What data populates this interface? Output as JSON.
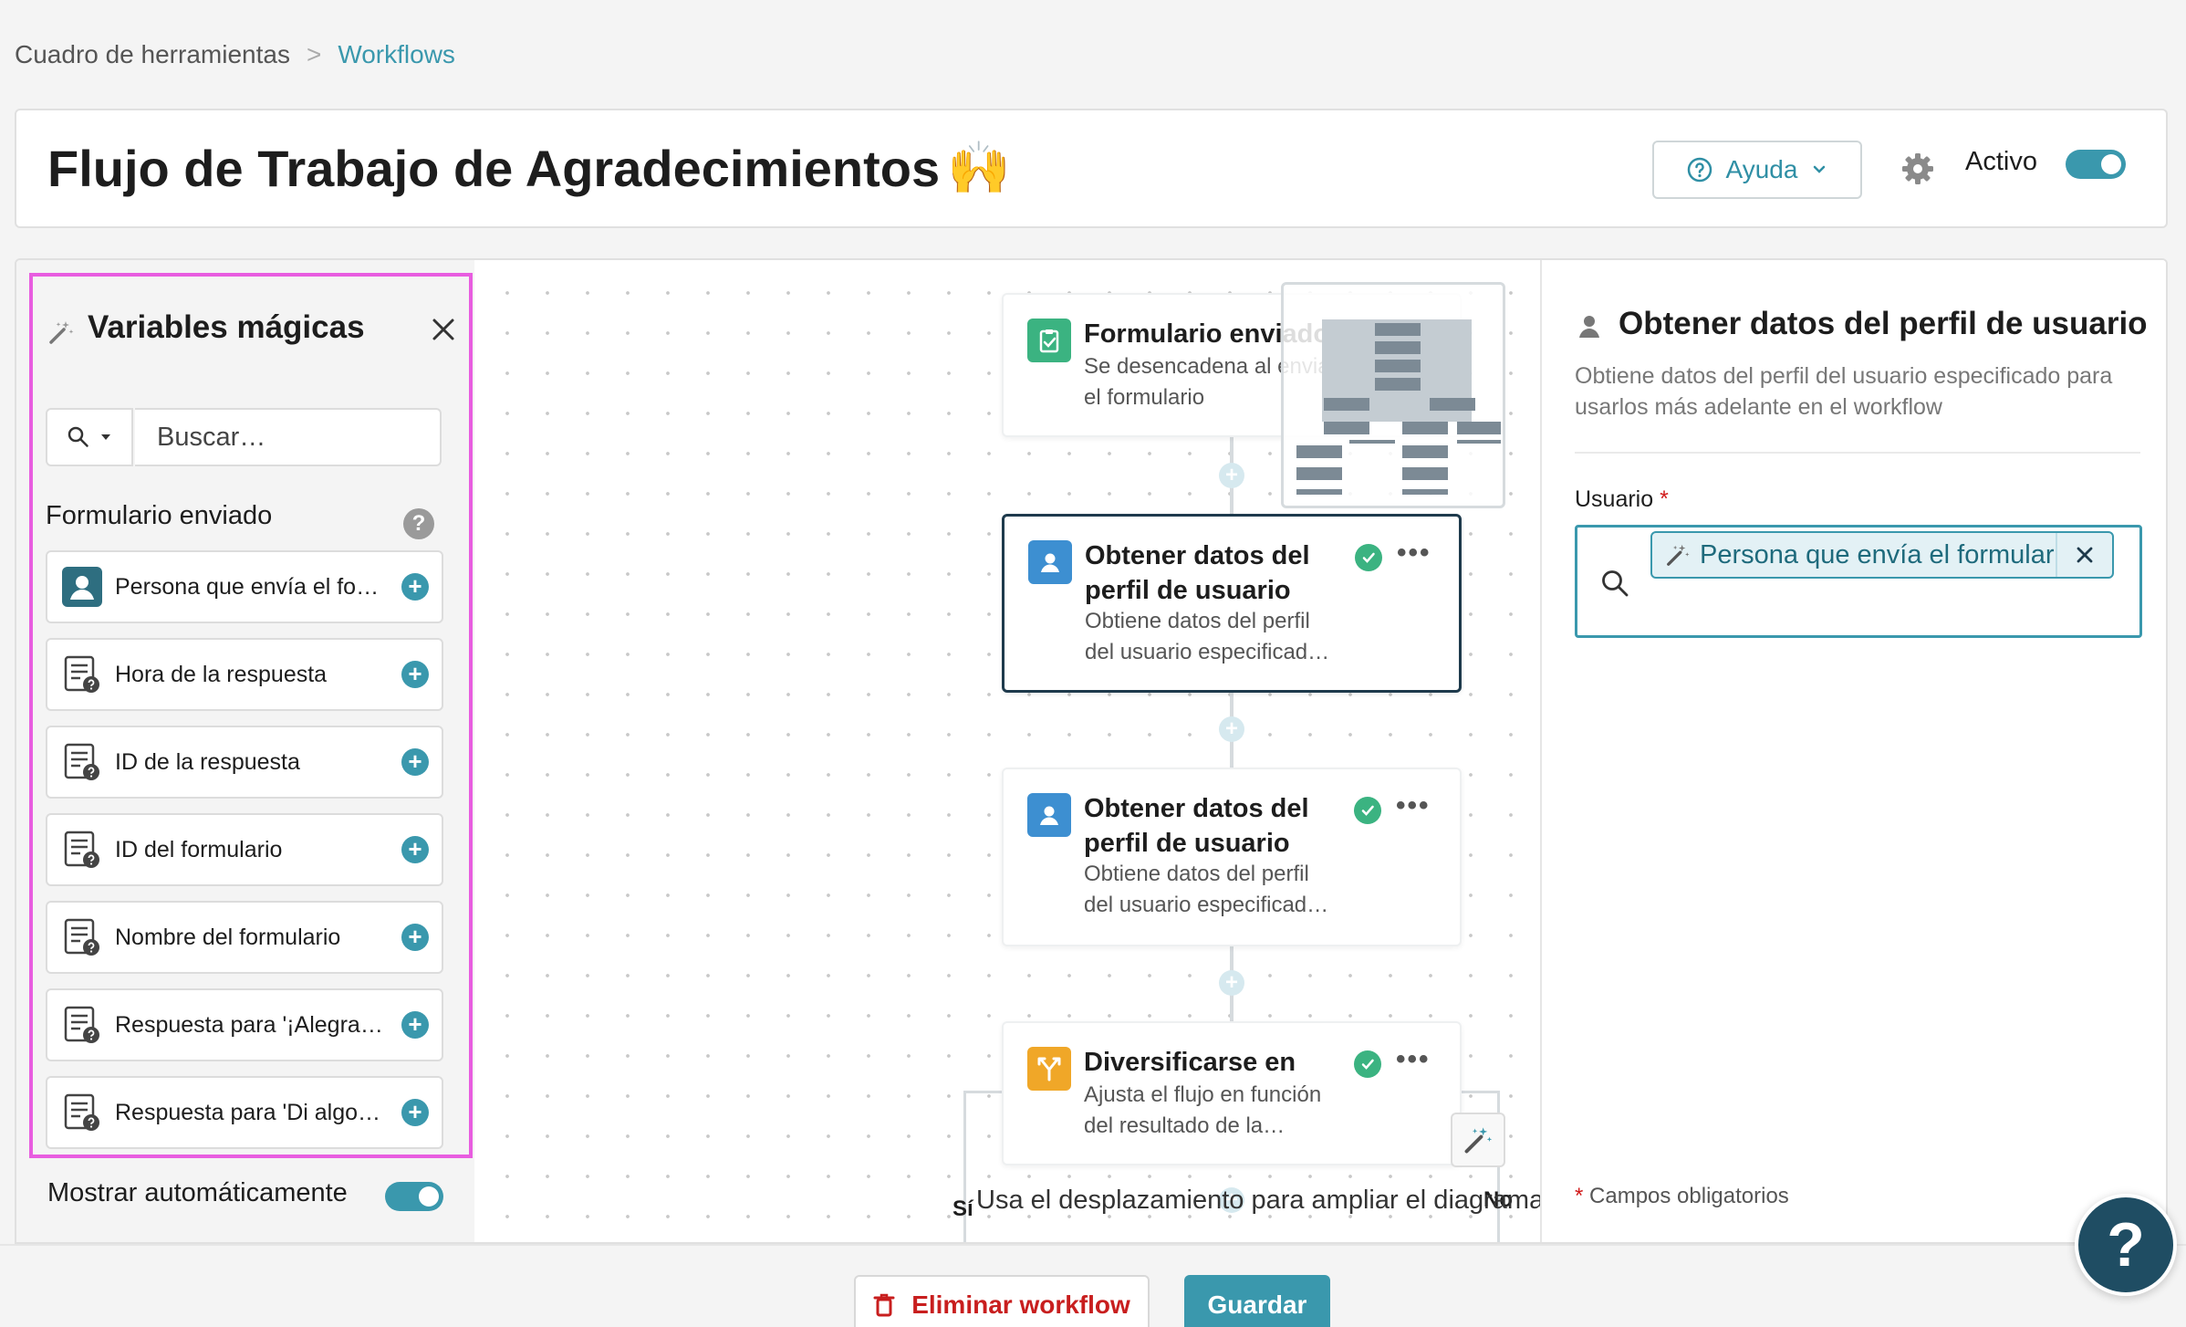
{
  "breadcrumb": {
    "home": "Cuadro de herramientas",
    "separator": ">",
    "current": "Workflows"
  },
  "header": {
    "title": "Flujo de Trabajo de Agradecimientos",
    "title_emoji": "🙌",
    "help_label": "Ayuda",
    "active_label": "Activo",
    "active": true
  },
  "magic_variables": {
    "title": "Variables mágicas",
    "search_placeholder": "Buscar…",
    "section_label": "Formulario enviado",
    "section_help": "?",
    "items": [
      {
        "label": "Persona que envía el formulario",
        "icon": "user-icon"
      },
      {
        "label": "Hora de la respuesta",
        "icon": "form-field-icon"
      },
      {
        "label": "ID de la respuesta",
        "icon": "form-field-icon"
      },
      {
        "label": "ID del formulario",
        "icon": "form-field-icon"
      },
      {
        "label": "Nombre del formulario",
        "icon": "form-field-icon"
      },
      {
        "label": "Respuesta para '¡Alegra el día de alguien!'",
        "icon": "form-field-icon"
      },
      {
        "label": "Respuesta para 'Di algo bonito'",
        "icon": "form-field-icon"
      }
    ],
    "add_symbol": "+",
    "auto_show_label": "Mostrar automáticamente",
    "auto_show": true
  },
  "canvas": {
    "nodes": [
      {
        "title": "Formulario enviado",
        "desc_1": "Se desencadena al enviar",
        "desc_2": "el formulario",
        "icon": "clipboard-check-icon",
        "color": "#3bb381"
      },
      {
        "title_1": "Obtener datos del",
        "title_2": "perfil de usuario",
        "desc_1": "Obtiene datos del perfil",
        "desc_2": "del usuario especificad…",
        "icon": "user-icon",
        "color": "#3d8fd1"
      },
      {
        "title_1": "Obtener datos del",
        "title_2": "perfil de usuario",
        "desc_1": "Obtiene datos del perfil",
        "desc_2": "del usuario especificad…",
        "icon": "user-icon",
        "color": "#3d8fd1"
      },
      {
        "title": "Diversificarse en",
        "desc_1": "Ajusta el flujo en función",
        "desc_2": "del resultado de la…",
        "icon": "branch-icon",
        "color": "#f0a728"
      }
    ],
    "more_symbol": "•••",
    "plus_symbol": "+",
    "branch_yes": "Sí",
    "branch_no": "No",
    "hint": "Usa el desplazamiento para ampliar el diagrama"
  },
  "details": {
    "title": "Obtener datos del perfil de usuario",
    "description": "Obtiene datos del perfil del usuario especificado para usarlos más adelante en el workflow",
    "field_label": "Usuario",
    "required_mark": "*",
    "chip_value": "Persona que envía el formular",
    "required_note": "Campos obligatorios"
  },
  "footer": {
    "delete_label": "Eliminar workflow",
    "save_label": "Guardar"
  },
  "help_fab": "?",
  "colors": {
    "accent": "#3a98ad",
    "highlight_border": "#e85de0",
    "danger": "#c81e1e",
    "success": "#3bb381",
    "branch": "#f0a728",
    "user_node": "#3d8fd1"
  }
}
